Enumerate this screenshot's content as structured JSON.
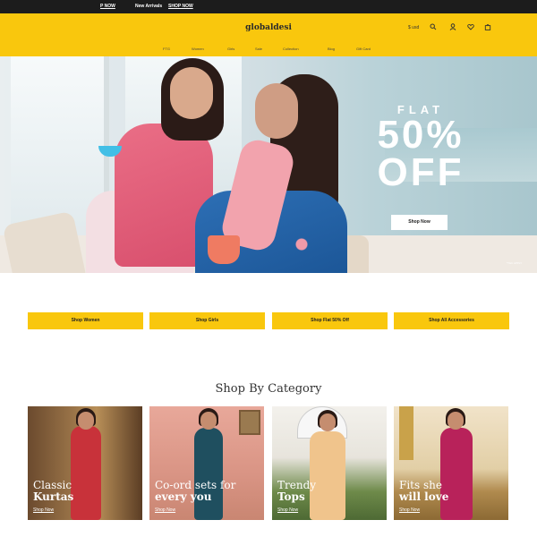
{
  "announcement": {
    "link1": "P NOW",
    "text": "New Arrivals",
    "link2": "SHOP NOW"
  },
  "header": {
    "logo": "globaldesi",
    "currency": "$ usd",
    "icons": [
      "search-icon",
      "user-icon",
      "heart-icon",
      "bag-icon"
    ],
    "nav": [
      "FTG",
      "Women",
      "Girls",
      "Sale",
      "Collection",
      "Blog",
      "Gift Card"
    ]
  },
  "hero": {
    "flat": "FLAT",
    "percent": "50%",
    "off": "OFF",
    "button": "Shop Now",
    "tc": "*T&C APPLY"
  },
  "ctas": [
    "Shop Women",
    "Shop Girls",
    "Shop Flat 50% Off",
    "Shop All Accessories"
  ],
  "category_title": "Shop By Category",
  "categories": [
    {
      "line1": "Classic",
      "line2": "Kurtas",
      "link": "Shop Now"
    },
    {
      "line1": "Co-ord sets for",
      "line2": "every you",
      "link": "Shop Now"
    },
    {
      "line1": "Trendy",
      "line2": "Tops",
      "link": "Shop Now"
    },
    {
      "line1": "Fits she",
      "line2": "will love",
      "link": "Shop Now"
    }
  ],
  "colors": {
    "brand_yellow": "#f9c70d",
    "topbar": "#1c1c1c"
  }
}
